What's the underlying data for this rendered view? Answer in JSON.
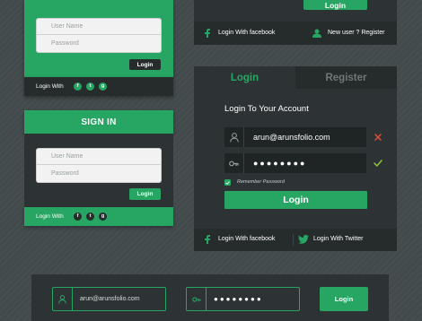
{
  "card1": {
    "username_placeholder": "User Name",
    "password_placeholder": "Password",
    "login_button": "Login",
    "social_label": "Login With",
    "social_icons": [
      "facebook-icon",
      "twitter-icon",
      "google-plus-icon"
    ]
  },
  "card2": {
    "title": "SIGN IN",
    "username_placeholder": "User Name",
    "password_placeholder": "Password",
    "login_button": "Login",
    "social_label": "Login With",
    "social_icons": [
      "facebook-icon",
      "twitter-icon",
      "google-plus-icon"
    ]
  },
  "top_right": {
    "login_button": "Login",
    "facebook_label": "Login With facebook",
    "register_label": "New user ? Register"
  },
  "login_panel": {
    "tab_login": "Login",
    "tab_register": "Register",
    "heading": "Login To Your Account",
    "username_value": "arun@arunsfolio.com",
    "password_value": "●●●●●●●●",
    "remember_label": "Remember Password",
    "login_button": "Login",
    "facebook_label": "Login With facebook",
    "twitter_label": "Login With Twitter"
  },
  "bottom_bar": {
    "username_value": "arun@arunsfolio.com",
    "password_value": "●●●●●●●●",
    "login_button": "Login"
  },
  "colors": {
    "accent": "#27a562",
    "panel": "#2d3335",
    "panel_dark": "#262b2c",
    "error": "#e0503a",
    "valid": "#8cc540"
  }
}
